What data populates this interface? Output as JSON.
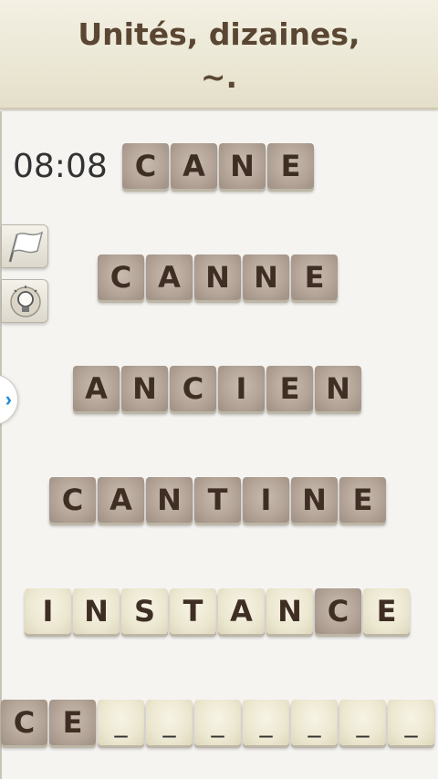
{
  "header": {
    "title_line1": "Unités, dizaines,",
    "title_line2": "~."
  },
  "timer": "08:08",
  "rows": [
    {
      "letters": [
        "C",
        "A",
        "N",
        "E"
      ],
      "style": "dark"
    },
    {
      "letters": [
        "C",
        "A",
        "N",
        "N",
        "E"
      ],
      "style": "dark"
    },
    {
      "letters": [
        "A",
        "N",
        "C",
        "I",
        "E",
        "N"
      ],
      "style": "dark"
    },
    {
      "letters": [
        "C",
        "A",
        "N",
        "T",
        "I",
        "N",
        "E"
      ],
      "style": "dark"
    },
    {
      "letters": [
        "I",
        "N",
        "S",
        "T",
        "A",
        "N",
        "C",
        "E"
      ],
      "style": "light",
      "highlighted": [
        6
      ]
    },
    {
      "letters": [
        "C",
        "E",
        "_",
        "_",
        "_",
        "_",
        "_",
        "_",
        "_"
      ],
      "style": "input",
      "highlighted": [
        0,
        1
      ]
    }
  ],
  "icons": {
    "flag": "flag-icon",
    "hint": "lightbulb-icon",
    "arrow": "chevron-right-icon"
  }
}
